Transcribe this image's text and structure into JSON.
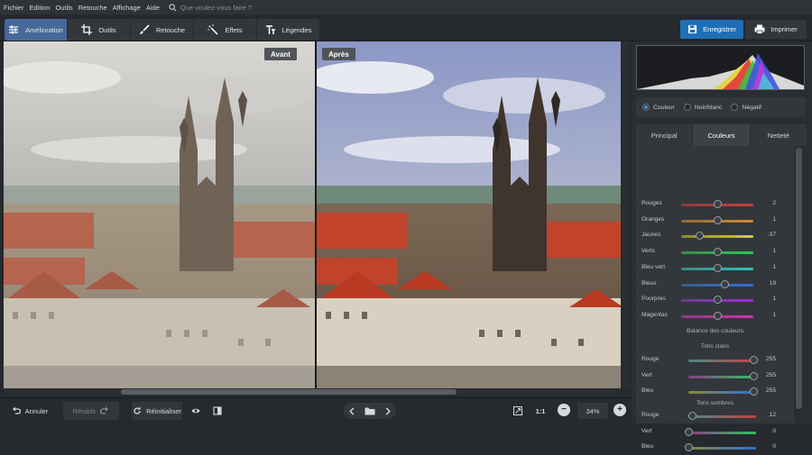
{
  "menu": {
    "items": [
      "Fichier",
      "Edition",
      "Outils",
      "Retouche",
      "Affichage",
      "Aide"
    ],
    "search_placeholder": "Que voulez-vous faire ?"
  },
  "toolbar": {
    "tabs": [
      {
        "label": "Amélioration",
        "icon": "sliders-icon"
      },
      {
        "label": "Outils",
        "icon": "crop-icon"
      },
      {
        "label": "Retouche",
        "icon": "brush-icon"
      },
      {
        "label": "Effets",
        "icon": "magic-wand-icon"
      },
      {
        "label": "Légendes",
        "icon": "text-icon"
      }
    ],
    "active_tab": "Amélioration",
    "save_label": "Enregistrer",
    "print_label": "Imprimer"
  },
  "viewer": {
    "before_label": "Avant",
    "after_label": "Après"
  },
  "panel": {
    "color_modes": [
      {
        "label": "Couleur",
        "selected": true
      },
      {
        "label": "Noir/blanc",
        "selected": false
      },
      {
        "label": "Négatif",
        "selected": false
      }
    ],
    "tabs": [
      "Principal",
      "Couleurs",
      "Netteté"
    ],
    "active_tab": "Couleurs",
    "color_sliders": [
      {
        "label": "Rouges",
        "value": "2",
        "pos": 0.51,
        "from": "#8a3d3d",
        "to": "#c4433d"
      },
      {
        "label": "Oranges",
        "value": "1",
        "pos": 0.5,
        "from": "#8a6a3d",
        "to": "#d68a2e"
      },
      {
        "label": "Jaunes",
        "value": "-37",
        "pos": 0.25,
        "from": "#8a873d",
        "to": "#d6cf2e"
      },
      {
        "label": "Verts",
        "value": "1",
        "pos": 0.5,
        "from": "#3d8a4a",
        "to": "#2ec45a"
      },
      {
        "label": "Bleu vert",
        "value": "1",
        "pos": 0.5,
        "from": "#3d8a86",
        "to": "#2ec4bd"
      },
      {
        "label": "Bleus",
        "value": "19",
        "pos": 0.6,
        "from": "#3d5f8a",
        "to": "#2e6fd6"
      },
      {
        "label": "Pourpres",
        "value": "1",
        "pos": 0.5,
        "from": "#6a3d8a",
        "to": "#a02ed6"
      },
      {
        "label": "Magentas",
        "value": "1",
        "pos": 0.5,
        "from": "#8a3d7a",
        "to": "#d62eb4"
      }
    ],
    "balance_title": "Balance des couleurs",
    "highlights_title": "Tons clairs",
    "highlights": [
      {
        "label": "Rouge",
        "value": "255",
        "pos": 0.97,
        "from": "#4a8a8a",
        "to": "#c4433d"
      },
      {
        "label": "Vert",
        "value": "255",
        "pos": 0.97,
        "from": "#8a3d8a",
        "to": "#2ec45a"
      },
      {
        "label": "Bleu",
        "value": "255",
        "pos": 0.97,
        "from": "#8a873d",
        "to": "#2e6fd6"
      }
    ],
    "shadows_title": "Tons sombres",
    "shadows": [
      {
        "label": "Rouge",
        "value": "12",
        "pos": 0.06,
        "from": "#4a8a8a",
        "to": "#c4433d"
      },
      {
        "label": "Vert",
        "value": "0",
        "pos": 0.0,
        "from": "#8a3d8a",
        "to": "#2ec45a"
      },
      {
        "label": "Bleu",
        "value": "0",
        "pos": 0.0,
        "from": "#8a873d",
        "to": "#2e6fd6"
      }
    ]
  },
  "bottom": {
    "undo_label": "Annuler",
    "redo_label": "Rétablir",
    "reset_label": "Réinitialiser",
    "ratio_label": "1:1",
    "zoom_value": "34%"
  }
}
